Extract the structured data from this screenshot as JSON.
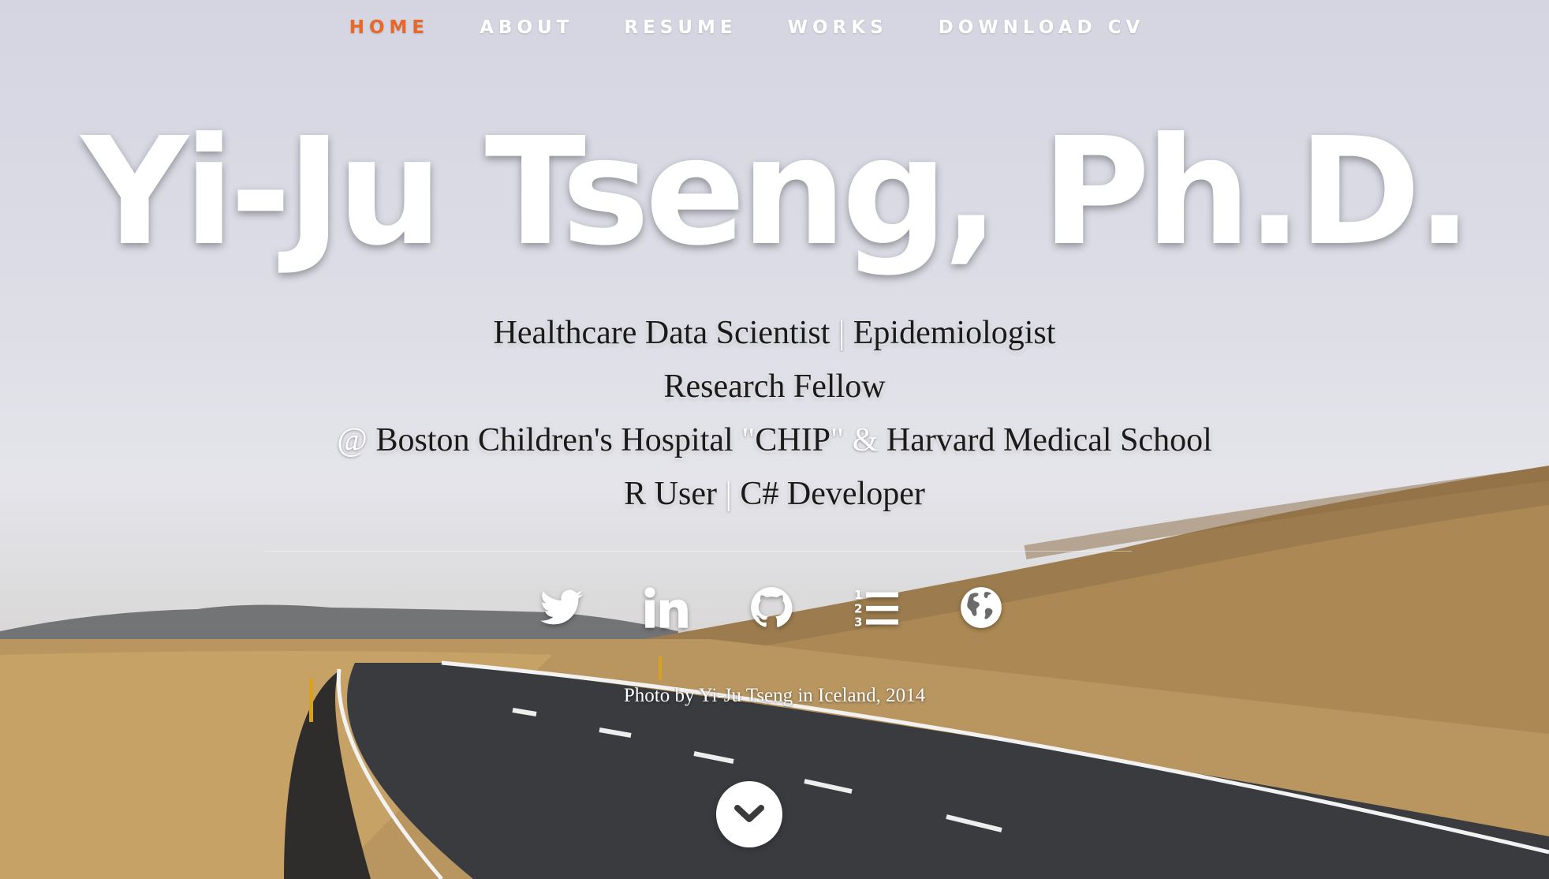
{
  "nav": {
    "items": [
      {
        "label": "HOME",
        "active": true
      },
      {
        "label": "ABOUT",
        "active": false
      },
      {
        "label": "RESUME",
        "active": false
      },
      {
        "label": "WORKS",
        "active": false
      },
      {
        "label": "DOWNLOAD CV",
        "active": false
      }
    ],
    "active_color": "#e8682a"
  },
  "hero": {
    "title": "Yi-Ju Tseng, Ph.D.",
    "line1_a": "Healthcare Data Scientist",
    "line1_sep": " | ",
    "line1_b": "Epidemiologist",
    "line2": "Research Fellow",
    "line3_at": "@ ",
    "line3_a": "Boston Children's Hospital ",
    "line3_q1": "\"",
    "line3_chip": "CHIP",
    "line3_q2": "\"",
    "line3_amp": " & ",
    "line3_b": "Harvard Medical School",
    "line4_a": "R User",
    "line4_sep": " | ",
    "line4_b": "C# Developer"
  },
  "social": {
    "icons": [
      "twitter-icon",
      "linkedin-icon",
      "github-icon",
      "ordered-list-icon",
      "globe-icon"
    ]
  },
  "credit": "Photo by Yi-Ju Tseng in Iceland, 2014",
  "scroll_down": {
    "icon": "chevron-down-icon"
  }
}
